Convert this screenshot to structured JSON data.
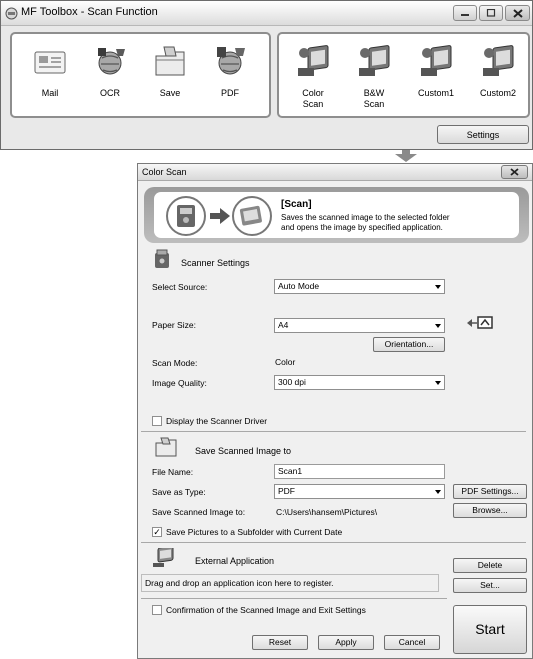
{
  "toolbox": {
    "title": "MF Toolbox - Scan Function",
    "left_items": [
      {
        "label": "Mail",
        "icon": "mail-icon"
      },
      {
        "label": "OCR",
        "icon": "ocr-icon"
      },
      {
        "label": "Save",
        "icon": "save-folder-icon"
      },
      {
        "label": "PDF",
        "icon": "pdf-icon"
      }
    ],
    "right_items": [
      {
        "label_line1": "Color",
        "label_line2": "Scan",
        "icon": "color-scan-icon"
      },
      {
        "label_line1": "B&W",
        "label_line2": "Scan",
        "icon": "bw-scan-icon"
      },
      {
        "label_line1": "Custom1",
        "label_line2": "",
        "icon": "custom1-icon"
      },
      {
        "label_line1": "Custom2",
        "label_line2": "",
        "icon": "custom2-icon"
      }
    ],
    "settings_label": "Settings"
  },
  "dialog": {
    "title": "Color Scan",
    "header": {
      "heading": "[Scan]",
      "desc_line1": "Saves the scanned image to the selected folder",
      "desc_line2": "and opens the image by specified application."
    },
    "scanner_settings": {
      "title": "Scanner Settings",
      "select_source_label": "Select Source:",
      "select_source_value": "Auto Mode",
      "paper_size_label": "Paper Size:",
      "paper_size_value": "A4",
      "orientation_label": "Orientation...",
      "scan_mode_label": "Scan Mode:",
      "scan_mode_value": "Color",
      "image_quality_label": "Image Quality:",
      "image_quality_value": "300 dpi",
      "display_driver_label": "Display the Scanner Driver",
      "display_driver_checked": false
    },
    "save_section": {
      "title": "Save Scanned Image to",
      "file_name_label": "File Name:",
      "file_name_value": "Scan1",
      "save_as_type_label": "Save as Type:",
      "save_as_type_value": "PDF",
      "pdf_settings_label": "PDF Settings...",
      "save_to_label": "Save Scanned Image to:",
      "save_to_value": "C:\\Users\\hansem\\Pictures\\",
      "browse_label": "Browse...",
      "subfolder_label": "Save Pictures to a Subfolder with Current Date",
      "subfolder_checked": true
    },
    "external_app": {
      "title": "External Application",
      "delete_label": "Delete",
      "drop_text": "Drag and drop an application icon here to register.",
      "set_label": "Set..."
    },
    "confirmation_label": "Confirmation of the Scanned Image and Exit Settings",
    "confirmation_checked": false,
    "reset_label": "Reset",
    "apply_label": "Apply",
    "cancel_label": "Cancel",
    "start_label": "Start"
  }
}
